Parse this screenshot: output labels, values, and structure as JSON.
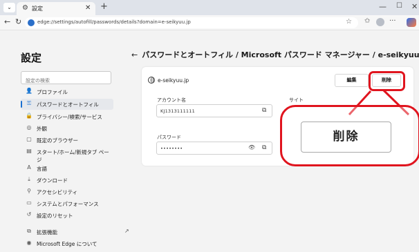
{
  "browser": {
    "tab_title": "設定",
    "url": "edge://settings/autofill/passwords/details?domain=e-seikyuu.jp"
  },
  "sidebar": {
    "title": "設定",
    "search_placeholder": "設定の検索",
    "items": [
      {
        "icon": "person-icon",
        "label": "プロファイル"
      },
      {
        "icon": "key-icon",
        "label": "パスワードとオートフィル",
        "active": true
      },
      {
        "icon": "lock-icon",
        "label": "プライバシー/検索/サービス"
      },
      {
        "icon": "palette-icon",
        "label": "外観"
      },
      {
        "icon": "browser-icon",
        "label": "既定のブラウザー"
      },
      {
        "icon": "home-icon",
        "label": "スタート/ホーム/新規タブ ページ"
      },
      {
        "icon": "language-icon",
        "label": "言語"
      },
      {
        "icon": "download-icon",
        "label": "ダウンロード"
      },
      {
        "icon": "accessibility-icon",
        "label": "アクセシビリティ"
      },
      {
        "icon": "system-icon",
        "label": "システムとパフォーマンス"
      },
      {
        "icon": "reset-icon",
        "label": "設定のリセット"
      },
      {
        "icon": "extensions-icon",
        "label": "拡張機能"
      },
      {
        "icon": "edge-icon",
        "label": "Microsoft Edge について"
      }
    ]
  },
  "main": {
    "breadcrumb": "パスワードとオートフィル / Microsoft パスワード マネージャー / e-seikyuu.jp",
    "site": "e-seikyuu.jp",
    "edit_label": "編集",
    "delete_label": "削除",
    "account_label": "アカウント名",
    "account_value": "KJ1313111111",
    "site_label": "サイト",
    "password_label": "パスワード",
    "password_value": "••••••••"
  },
  "annotation": {
    "zoom_label": "削除",
    "color": "#e0141e"
  }
}
